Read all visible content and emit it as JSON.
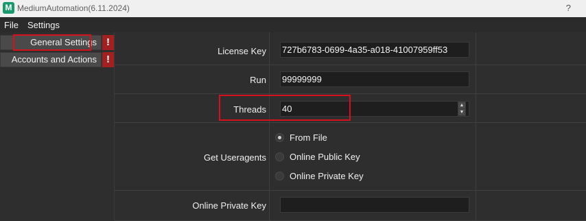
{
  "window": {
    "title": "MediumAutomation(6.11.2024)",
    "app_icon_letter": "M",
    "help": "?"
  },
  "menu": {
    "file": "File",
    "settings": "Settings"
  },
  "sidebar": {
    "items": [
      {
        "label": "General Settings",
        "badge": "!"
      },
      {
        "label": "Accounts and Actions",
        "badge": "!"
      }
    ]
  },
  "settings": {
    "license_key": {
      "label": "License Key",
      "value": "727b6783-0699-4a35-a018-41007959ff53"
    },
    "run": {
      "label": "Run",
      "value": "99999999"
    },
    "threads": {
      "label": "Threads",
      "value": "40"
    },
    "useragents": {
      "label": "Get Useragents",
      "options": [
        "From File",
        "Online Public Key",
        "Online Private Key"
      ],
      "selected": "From File"
    },
    "online_private_key": {
      "label": "Online Private Key",
      "value": ""
    }
  },
  "colors": {
    "accent_outline": "#d8101a",
    "warning_badge": "#a32020",
    "app_icon": "#1a9a6c"
  },
  "icons": {
    "spin_up": "up-arrow-icon",
    "spin_down": "down-arrow-icon"
  }
}
